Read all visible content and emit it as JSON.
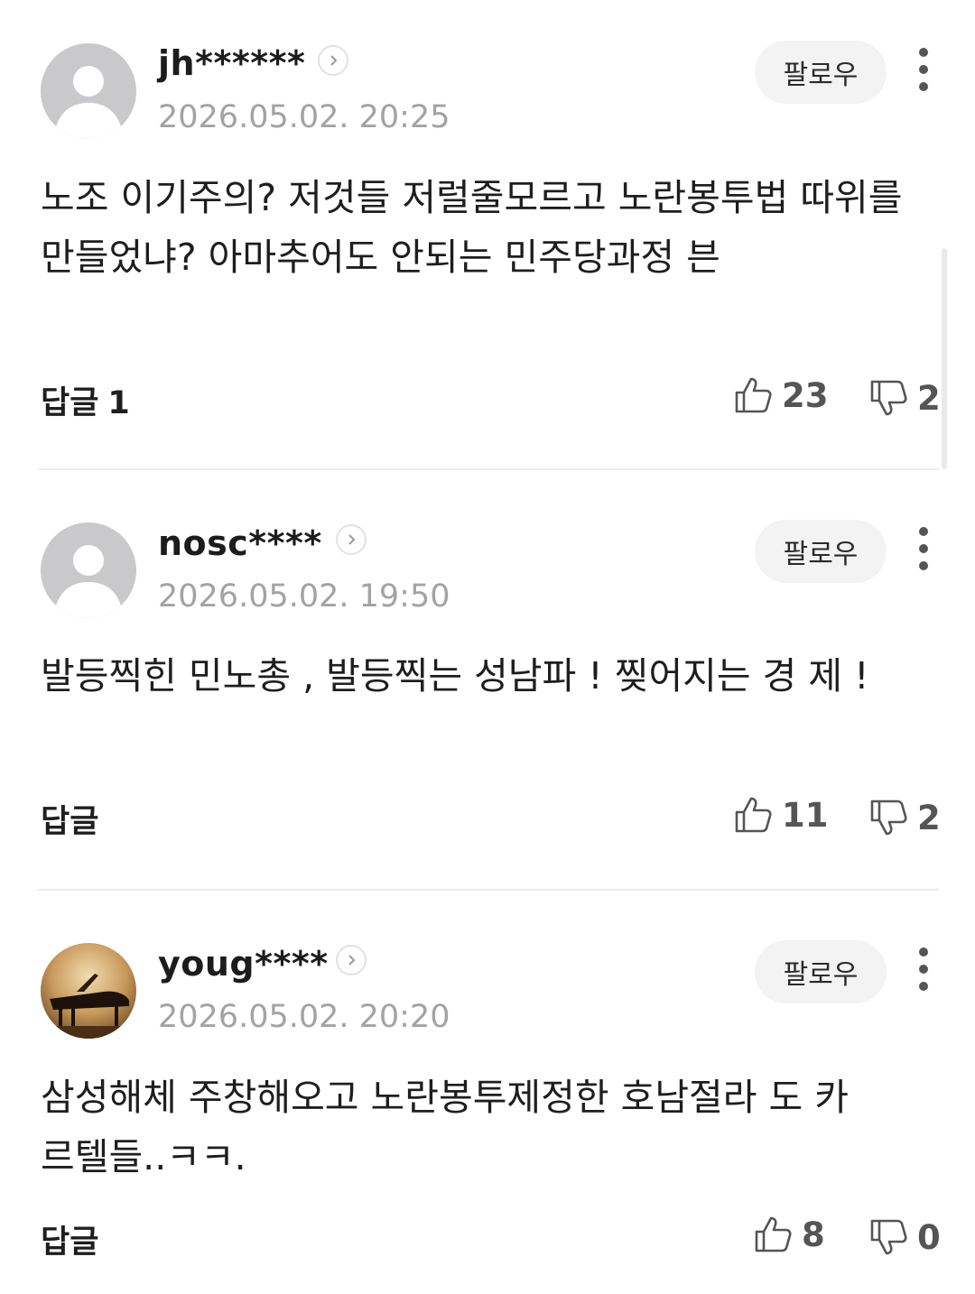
{
  "comments": [
    {
      "username": "jh******",
      "timestamp": "2026.05.02. 20:25",
      "follow_label": "팔로우",
      "body": "노조 이기주의? 저것들 저럴줄모르고 노란봉투법 따위를 만들었냐? 아마추어도 안되는 민주당과정 븐",
      "reply_label": "답글",
      "reply_count": "1",
      "likes": "23",
      "dislikes": "2",
      "avatar": "default-avatar"
    },
    {
      "username": "nosc****",
      "timestamp": "2026.05.02. 19:50",
      "follow_label": "팔로우",
      "body": "발등찍힌 민노총 , 발등찍는 성남파 ! 찢어지는 경 제 !",
      "reply_label": "답글",
      "reply_count": "",
      "likes": "11",
      "dislikes": "2",
      "avatar": "default-avatar"
    },
    {
      "username": "youg****",
      "timestamp": "2026.05.02. 20:20",
      "follow_label": "팔로우",
      "body": "삼성해체 주창해오고 노란봉투제정한 호남절라 도 카르텔들..ㅋㅋ.",
      "reply_label": "답글",
      "reply_count": "",
      "likes": "8",
      "dislikes": "0",
      "avatar": "piano-photo-avatar"
    }
  ],
  "colors": {
    "text": "#1e1e1e",
    "muted": "#a3a3a3",
    "follow_bg": "#f3f3f3",
    "divider": "#ececec"
  }
}
